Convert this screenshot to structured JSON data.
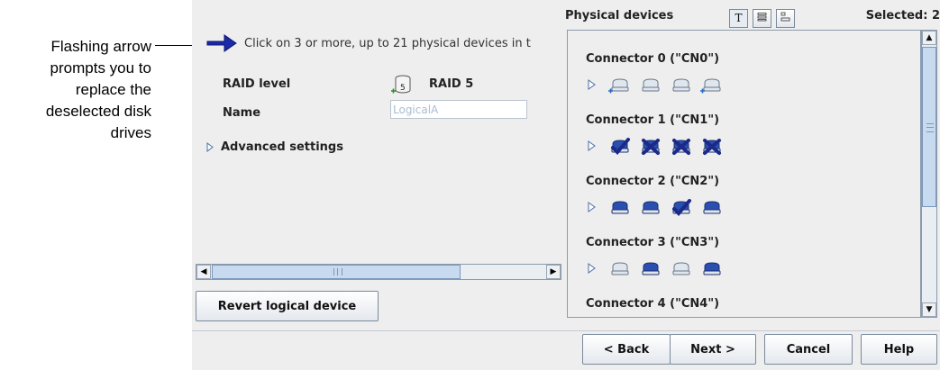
{
  "annotation": {
    "lines": [
      "Flashing arrow",
      "prompts you to",
      "replace the",
      "deselected disk",
      "drives"
    ]
  },
  "left_pane": {
    "instruction": "Click on 3 or more, up to 21 physical devices in t",
    "raid_level_label": "RAID level",
    "raid_level_value": "RAID 5",
    "raid_icon_digit": "5",
    "name_label": "Name",
    "name_value": "LogicalA",
    "advanced_label": "Advanced settings",
    "revert_label": "Revert logical device"
  },
  "physical_devices": {
    "title": "Physical devices",
    "view_buttons": [
      "T",
      "list",
      "tree"
    ],
    "selected_text": "Selected: 2",
    "connectors": [
      {
        "label": "Connector 0 (\"CN0\")",
        "drives": [
          "add",
          "empty",
          "empty",
          "add"
        ]
      },
      {
        "label": "Connector 1 (\"CN1\")",
        "drives": [
          "check",
          "x",
          "x",
          "x"
        ]
      },
      {
        "label": "Connector 2 (\"CN2\")",
        "drives": [
          "normal",
          "normal",
          "check",
          "normal"
        ]
      },
      {
        "label": "Connector 3 (\"CN3\")",
        "drives": [
          "empty",
          "normal",
          "empty",
          "normal"
        ]
      },
      {
        "label": "Connector 4 (\"CN4\")",
        "drives": []
      }
    ]
  },
  "footer": {
    "back_label": "< Back",
    "next_label": "Next >",
    "cancel_label": "Cancel",
    "help_label": "Help"
  },
  "colors": {
    "arrow_blue": "#1a2aa8",
    "drive_blue": "#2a4fb0",
    "drive_light": "#dfe6ee",
    "scroll_thumb": "#c7daf0"
  }
}
